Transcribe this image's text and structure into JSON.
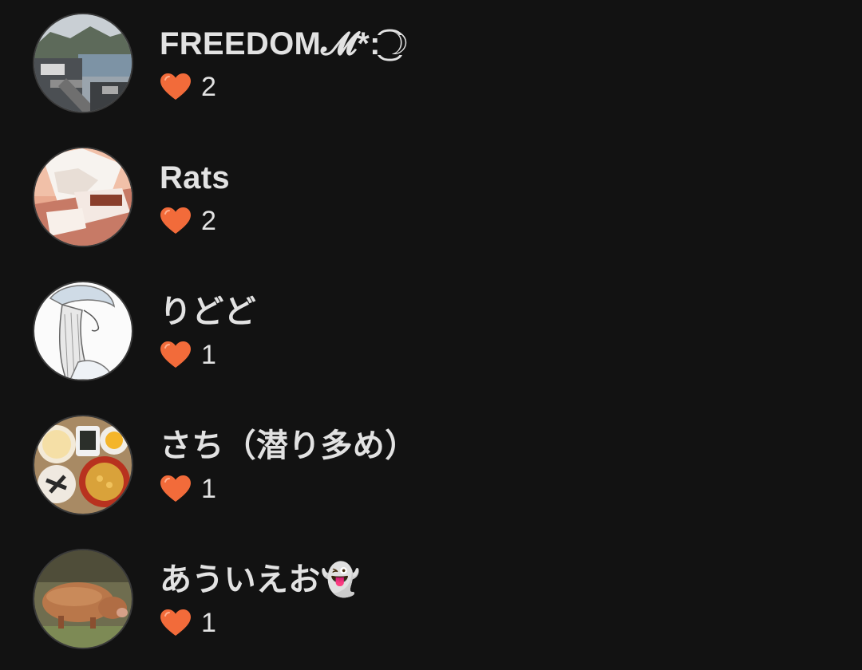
{
  "likers": [
    {
      "name": "FREEDOM𝓜*:͜͡☽",
      "likes": "2",
      "avatar_icon": "harbor-town-photo-avatar"
    },
    {
      "name": "Rats",
      "likes": "2",
      "avatar_icon": "anime-character-avatar"
    },
    {
      "name": "りどど",
      "likes": "1",
      "avatar_icon": "sketch-girl-avatar"
    },
    {
      "name": "さち（潜り多め）",
      "likes": "1",
      "avatar_icon": "meal-tray-photo-avatar"
    },
    {
      "name": "あういえお👻",
      "likes": "1",
      "avatar_icon": "pig-photo-avatar"
    }
  ],
  "colors": {
    "background": "#121212",
    "heart": "#f26b3a",
    "text": "#e2e2e2"
  }
}
